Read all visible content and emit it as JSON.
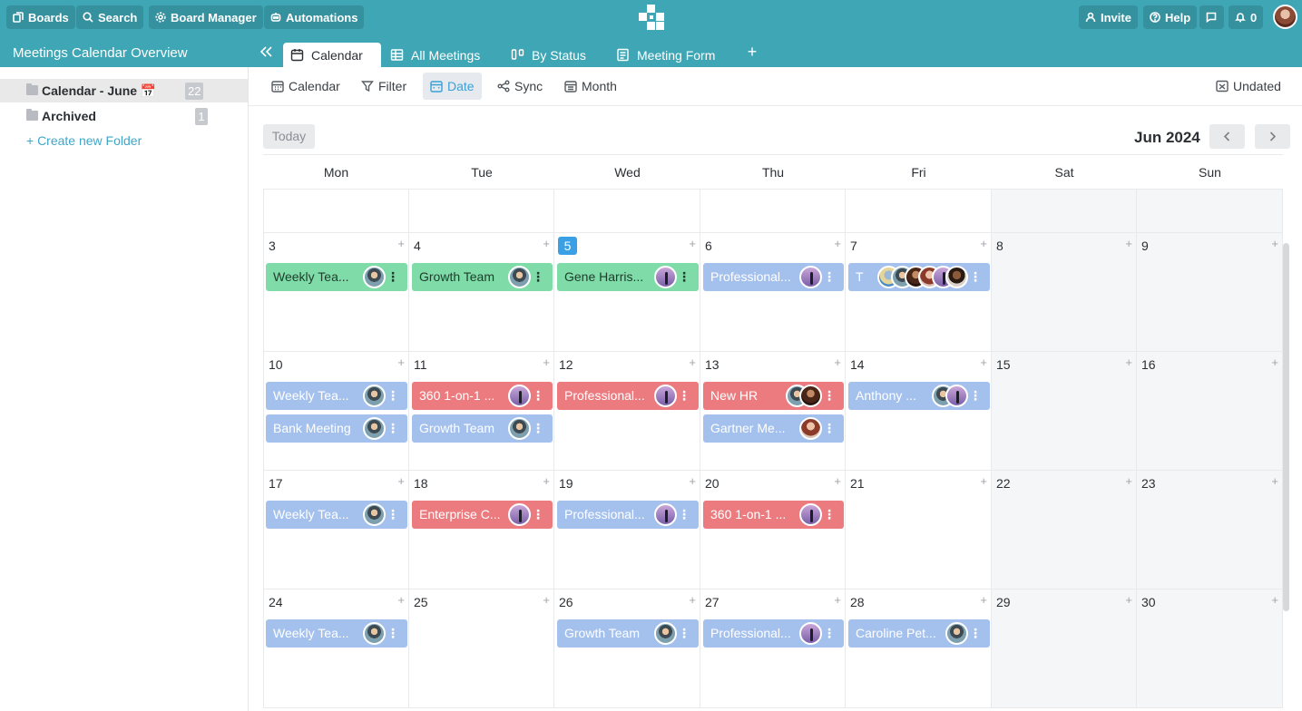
{
  "topbar": {
    "boards": "Boards",
    "search": "Search",
    "board_manager": "Board Manager",
    "automations": "Automations",
    "invite": "Invite",
    "help": "Help",
    "notifications": "0"
  },
  "board": {
    "title": "Meetings Calendar Overview",
    "tabs": [
      {
        "label": "Calendar",
        "icon": "calendar-icon"
      },
      {
        "label": "All Meetings",
        "icon": "table-icon"
      },
      {
        "label": "By Status",
        "icon": "kanban-icon"
      },
      {
        "label": "Meeting Form",
        "icon": "form-icon"
      }
    ]
  },
  "sidebar": {
    "folders": [
      {
        "label": "Calendar - June 📅",
        "count": "22"
      },
      {
        "label": "Archived",
        "count": "1"
      }
    ],
    "create_label": "+ Create new Folder"
  },
  "toolbar": {
    "calendar": "Calendar",
    "filter": "Filter",
    "date": "Date",
    "sync": "Sync",
    "month": "Month",
    "undated": "Undated"
  },
  "calendar": {
    "today_label": "Today",
    "month_label": "Jun 2024",
    "weekdays": [
      "Mon",
      "Tue",
      "Wed",
      "Thu",
      "Fri",
      "Sat",
      "Sun"
    ],
    "today_day": "5",
    "weeks": [
      [
        "",
        "",
        "",
        "",
        "",
        "",
        ""
      ],
      [
        "3",
        "4",
        "5",
        "6",
        "7",
        "8",
        "9"
      ],
      [
        "10",
        "11",
        "12",
        "13",
        "14",
        "15",
        "16"
      ],
      [
        "17",
        "18",
        "19",
        "20",
        "21",
        "22",
        "23"
      ],
      [
        "24",
        "25",
        "26",
        "27",
        "28",
        "29",
        "30"
      ]
    ],
    "events": [
      {
        "week": 1,
        "day": 0,
        "slot": 0,
        "title": "Weekly Tea...",
        "color": "green",
        "avatars": [
          "a1"
        ]
      },
      {
        "week": 1,
        "day": 1,
        "slot": 0,
        "title": "Growth Team",
        "color": "green",
        "avatars": [
          "a1"
        ]
      },
      {
        "week": 1,
        "day": 2,
        "slot": 0,
        "title": "Gene Harris...",
        "color": "green",
        "avatars": [
          "a2"
        ]
      },
      {
        "week": 1,
        "day": 3,
        "slot": 0,
        "title": "Professional...",
        "color": "blue",
        "avatars": [
          "a2"
        ]
      },
      {
        "week": 1,
        "day": 4,
        "slot": 0,
        "title": "T",
        "color": "blue",
        "avatars": [
          "a5",
          "a1",
          "a3",
          "a4",
          "a2",
          "a6"
        ]
      },
      {
        "week": 2,
        "day": 0,
        "slot": 0,
        "title": "Weekly Tea...",
        "color": "blue",
        "avatars": [
          "a1"
        ]
      },
      {
        "week": 2,
        "day": 0,
        "slot": 1,
        "title": "Bank Meeting",
        "color": "blue",
        "avatars": [
          "a1"
        ]
      },
      {
        "week": 2,
        "day": 1,
        "slot": 0,
        "title": "360 1-on-1 ...",
        "color": "red",
        "avatars": [
          "a2"
        ]
      },
      {
        "week": 2,
        "day": 1,
        "slot": 1,
        "title": "Growth Team",
        "color": "blue",
        "avatars": [
          "a1"
        ]
      },
      {
        "week": 2,
        "day": 2,
        "slot": 0,
        "title": "Professional...",
        "color": "red",
        "avatars": [
          "a2"
        ]
      },
      {
        "week": 2,
        "day": 3,
        "slot": 0,
        "title": "New HR",
        "color": "red",
        "avatars": [
          "a1",
          "a3"
        ]
      },
      {
        "week": 2,
        "day": 3,
        "slot": 1,
        "title": "Gartner Me...",
        "color": "blue",
        "avatars": [
          "a4"
        ]
      },
      {
        "week": 2,
        "day": 4,
        "slot": 0,
        "title": "Anthony ...",
        "color": "blue",
        "avatars": [
          "a1",
          "a2"
        ]
      },
      {
        "week": 3,
        "day": 0,
        "slot": 0,
        "title": "Weekly Tea...",
        "color": "blue",
        "avatars": [
          "a1"
        ]
      },
      {
        "week": 3,
        "day": 1,
        "slot": 0,
        "title": "Enterprise C...",
        "color": "red",
        "avatars": [
          "a2"
        ]
      },
      {
        "week": 3,
        "day": 2,
        "slot": 0,
        "title": "Professional...",
        "color": "blue",
        "avatars": [
          "a2"
        ]
      },
      {
        "week": 3,
        "day": 3,
        "slot": 0,
        "title": "360 1-on-1 ...",
        "color": "red",
        "avatars": [
          "a2"
        ]
      },
      {
        "week": 4,
        "day": 0,
        "slot": 0,
        "title": "Weekly Tea...",
        "color": "blue",
        "avatars": [
          "a1"
        ]
      },
      {
        "week": 4,
        "day": 2,
        "slot": 0,
        "title": "Growth Team",
        "color": "blue",
        "avatars": [
          "a1"
        ]
      },
      {
        "week": 4,
        "day": 3,
        "slot": 0,
        "title": "Professional...",
        "color": "blue",
        "avatars": [
          "a2"
        ]
      },
      {
        "week": 4,
        "day": 4,
        "slot": 0,
        "title": "Caroline Pet...",
        "color": "blue",
        "avatars": [
          "a1"
        ]
      }
    ]
  },
  "colors": {
    "brand": "#3ea6b5",
    "today_badge": "#3aa0e6",
    "event_green": "#7fdca9",
    "event_blue": "#a4c1ee",
    "event_red": "#eb7b7f"
  }
}
